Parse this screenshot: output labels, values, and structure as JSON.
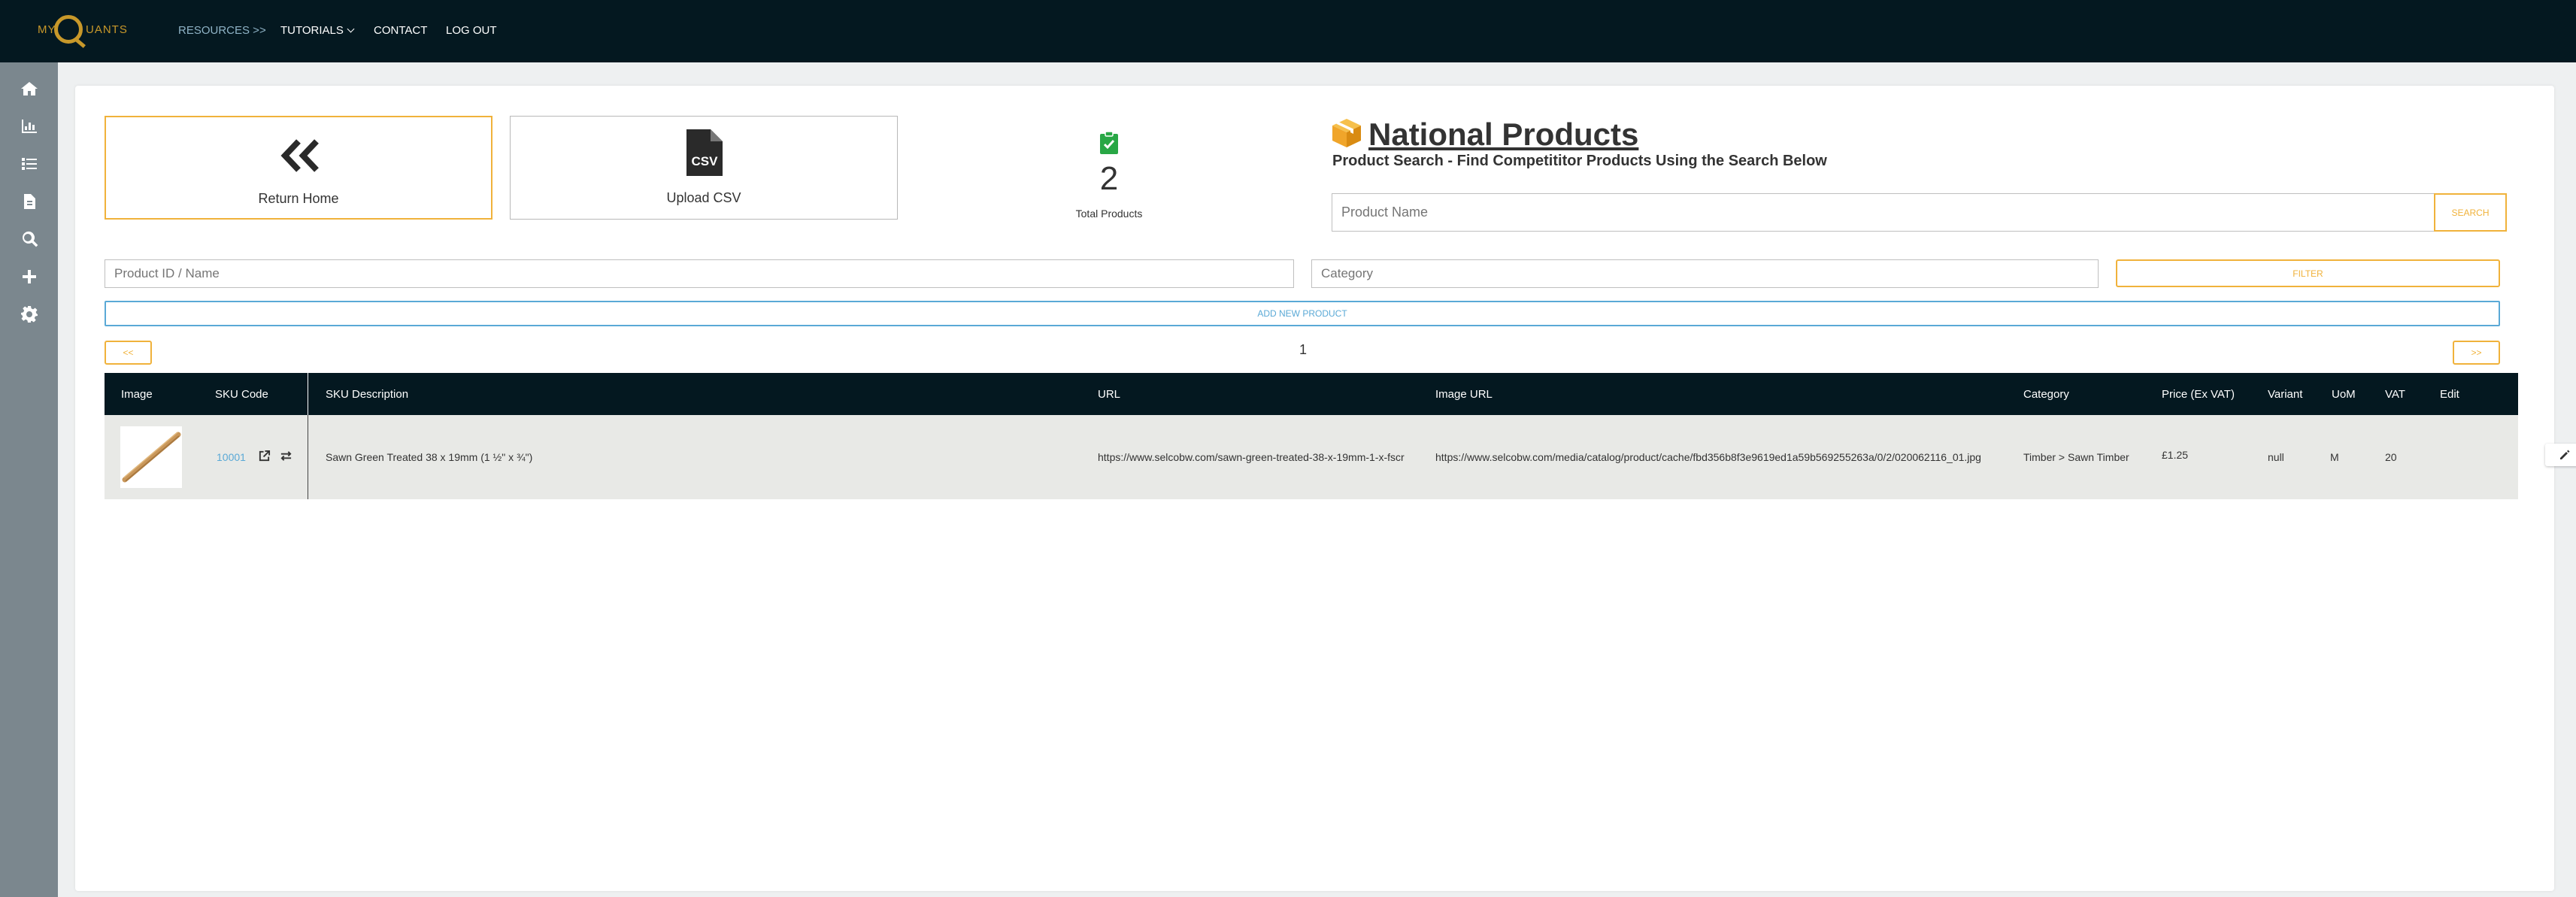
{
  "app": {
    "logo_left": "MY",
    "logo_right": "UANTS"
  },
  "nav": {
    "resources": "RESOURCES >>",
    "tutorials": "TUTORIALS",
    "contact": "CONTACT",
    "logout": "LOG OUT"
  },
  "sidebar": {
    "items": [
      "home-icon",
      "bar-chart-icon",
      "list-icon",
      "document-icon",
      "search-icon",
      "plus-icon",
      "gear-icon"
    ]
  },
  "tiles": {
    "home_label": "Return Home",
    "csv_label": "Upload CSV",
    "csv_badge": "CSV"
  },
  "stats": {
    "total_products_value": "2",
    "total_products_label": "Total Products"
  },
  "header": {
    "title": "National Products",
    "subtitle": "Product Search - Find Competititor Products Using the Search Below"
  },
  "search": {
    "placeholder": "Product Name",
    "button": "SEARCH"
  },
  "filters": {
    "product_placeholder": "Product ID / Name",
    "category_placeholder": "Category",
    "filter_button": "FILTER",
    "add_button": "ADD NEW PRODUCT"
  },
  "pagination": {
    "prev": "<<",
    "next": ">>",
    "current_page": "1"
  },
  "table": {
    "columns": [
      "Image",
      "SKU Code",
      "SKU Description",
      "URL",
      "Image URL",
      "Category",
      "Price (Ex VAT)",
      "Variant",
      "UoM",
      "VAT",
      "Edit"
    ],
    "rows": [
      {
        "sku_code": "10001",
        "description": "Sawn Green Treated 38 x 19mm (1 ½\" x ¾\")",
        "url": "https://www.selcobw.com/sawn-green-treated-38-x-19mm-1-x-fscr",
        "image_url": "https://www.selcobw.com/media/catalog/product/cache/fbd356b8f3e9619ed1a59b569255263a/0/2/020062116_01.jpg",
        "category": "Timber > Sawn Timber",
        "price": "£1.25",
        "variant": "null",
        "uom": "M",
        "vat": "20"
      }
    ]
  },
  "colors": {
    "topbar": "#041820",
    "sidebar": "#7b878e",
    "accent_orange": "#f0b23b",
    "accent_blue": "#5aa9d6",
    "check_green": "#28a745",
    "box_orange": "#f0a52a"
  }
}
